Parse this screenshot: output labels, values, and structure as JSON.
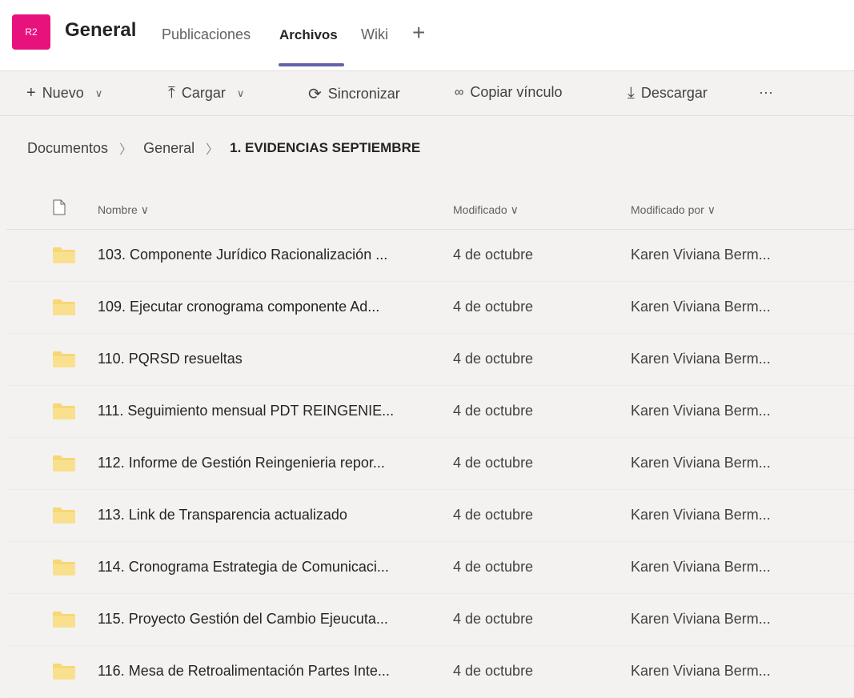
{
  "header": {
    "team_avatar": "R2",
    "channel": "General",
    "tabs": [
      {
        "label": "Publicaciones"
      },
      {
        "label": "Archivos"
      },
      {
        "label": "Wiki"
      }
    ],
    "add_tab": "+"
  },
  "toolbar": {
    "new_label": "Nuevo",
    "upload_label": "Cargar",
    "sync_label": "Sincronizar",
    "copy_link_label": "Copiar vínculo",
    "download_label": "Descargar",
    "more": "···"
  },
  "breadcrumb": {
    "root": "Documentos",
    "parent": "General",
    "current": "1. EVIDENCIAS SEPTIEMBRE"
  },
  "columns": {
    "name": "Nombre",
    "modified": "Modificado",
    "modified_by": "Modificado por"
  },
  "rows": [
    {
      "name": "103. Componente Jurídico Racionalización ...",
      "modified": "4 de octubre",
      "modified_by": "Karen Viviana Berm..."
    },
    {
      "name": "109. Ejecutar cronograma componente Ad...",
      "modified": "4 de octubre",
      "modified_by": "Karen Viviana Berm..."
    },
    {
      "name": "110. PQRSD resueltas",
      "modified": "4 de octubre",
      "modified_by": "Karen Viviana Berm..."
    },
    {
      "name": "111. Seguimiento mensual PDT REINGENIE...",
      "modified": "4 de octubre",
      "modified_by": "Karen Viviana Berm..."
    },
    {
      "name": "112. Informe de Gestión Reingenieria repor...",
      "modified": "4 de octubre",
      "modified_by": "Karen Viviana Berm..."
    },
    {
      "name": "113. Link de Transparencia actualizado",
      "modified": "4 de octubre",
      "modified_by": "Karen Viviana Berm..."
    },
    {
      "name": "114. Cronograma Estrategia de Comunicaci...",
      "modified": "4 de octubre",
      "modified_by": "Karen Viviana Berm..."
    },
    {
      "name": "115. Proyecto Gestión del Cambio Ejeucuta...",
      "modified": "4 de octubre",
      "modified_by": "Karen Viviana Berm..."
    },
    {
      "name": "116. Mesa de Retroalimentación Partes Inte...",
      "modified": "4 de octubre",
      "modified_by": "Karen Viviana Berm..."
    }
  ],
  "colors": {
    "accent": "#6264a7",
    "avatar": "#e8127c",
    "folder": "#f8d775"
  }
}
